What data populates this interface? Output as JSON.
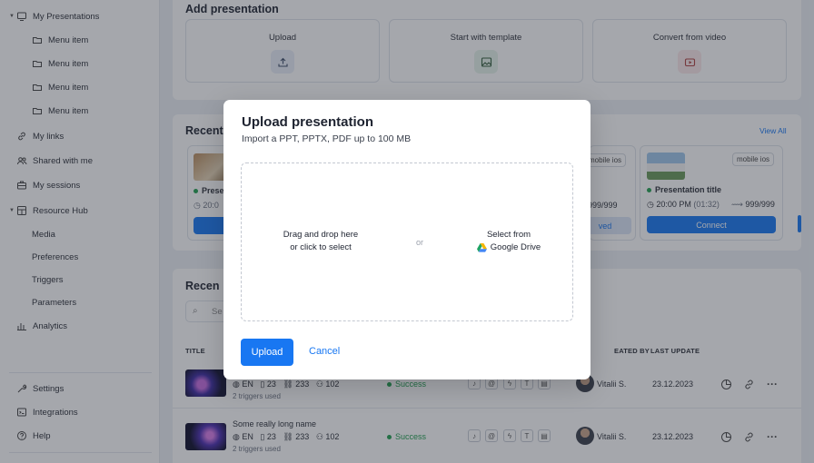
{
  "sidebar": {
    "my_presentations": "My Presentations",
    "menu_items": [
      "Menu item",
      "Menu item",
      "Menu item",
      "Menu item"
    ],
    "my_links": "My links",
    "shared_with_me": "Shared with me",
    "my_sessions": "My sessions",
    "resource_hub": "Resource Hub",
    "hub_items": [
      "Media",
      "Preferences",
      "Triggers",
      "Parameters"
    ],
    "analytics": "Analytics",
    "settings": "Settings",
    "integrations": "Integrations",
    "help": "Help"
  },
  "add_presentation": {
    "title": "Add presentation",
    "options": [
      {
        "label": "Upload",
        "icon": "upload-icon",
        "color": "#e8eef8"
      },
      {
        "label": "Start with template",
        "icon": "image-icon",
        "color": "#e6f3ea"
      },
      {
        "label": "Convert from video",
        "icon": "video-icon",
        "color": "#fbe9ea"
      }
    ]
  },
  "recent_cards": {
    "title": "Recent",
    "view_all": "View All",
    "cards": [
      {
        "chip": "",
        "title": "Prese",
        "time": "20:0",
        "duration": "",
        "views": "",
        "button": ""
      },
      {
        "chip": "mobile ios",
        "title": "",
        "time": "",
        "duration": "",
        "views": "999/999",
        "button": "ved"
      },
      {
        "chip": "mobile ios",
        "title": "Presentation title",
        "time": "20:00 PM",
        "duration": "(01:32)",
        "views": "999/999",
        "button": "Connect"
      }
    ]
  },
  "recent_table": {
    "title": "Recen",
    "search_placeholder": "Se",
    "headers": {
      "title": "TITLE",
      "created_by": "EATED BY",
      "last_update": "LAST UPDATE"
    },
    "rows": [
      {
        "name": "",
        "lang": "EN",
        "slides": "23",
        "links": "233",
        "viewers": "102",
        "triggers": "2 triggers used",
        "status": "Success",
        "author": "Vitalii S.",
        "date": "23.12.2023"
      },
      {
        "name": "Some really long name",
        "lang": "EN",
        "slides": "23",
        "links": "233",
        "viewers": "102",
        "triggers": "2 triggers used",
        "status": "Success",
        "author": "Vitalii S.",
        "date": "23.12.2023"
      }
    ]
  },
  "modal": {
    "title": "Upload presentation",
    "subtitle": "Import a PPT, PPTX, PDF up to 100 MB",
    "drop_line1": "Drag and drop here",
    "drop_line2": "or click to select",
    "or": "or",
    "select_from": "Select from",
    "google_drive": "Google Drive",
    "upload_label": "Upload",
    "cancel_label": "Cancel"
  },
  "colors": {
    "accent": "#1877f2",
    "success": "#22a050",
    "overlay": "rgba(40,46,58,0.42)"
  }
}
